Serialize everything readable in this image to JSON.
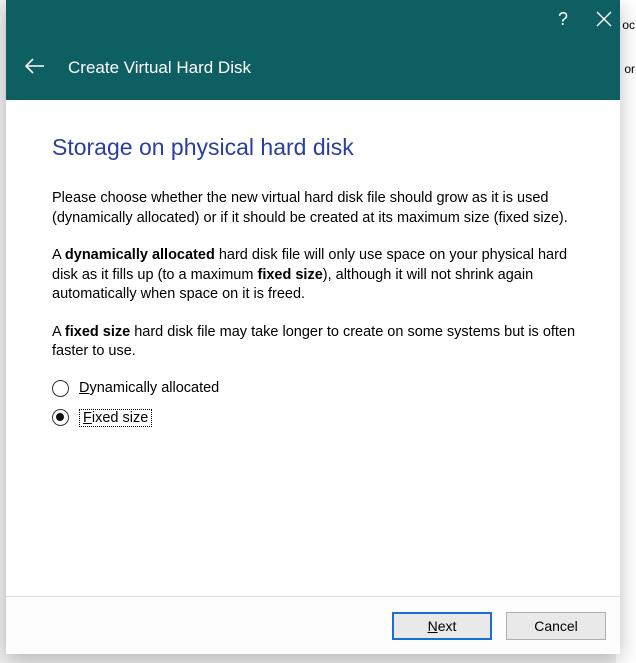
{
  "window": {
    "title": "Create Virtual Hard Disk",
    "help_icon": "?",
    "close_icon": "×",
    "back_icon": "←"
  },
  "page": {
    "heading": "Storage on physical hard disk",
    "paragraphs": {
      "p1": "Please choose whether the new virtual hard disk file should grow as it is used (dynamically allocated) or if it should be created at its maximum size (fixed size).",
      "p2_a": "A ",
      "p2_b_strong": "dynamically allocated",
      "p2_c": " hard disk file will only use space on your physical hard disk as it fills up (to a maximum ",
      "p2_d_strong": "fixed size",
      "p2_e": "), although it will not shrink again automatically when space on it is freed.",
      "p3_a": "A ",
      "p3_b_strong": "fixed size",
      "p3_c": " hard disk file may take longer to create on some systems but is often faster to use."
    }
  },
  "options": {
    "dynamic": {
      "mnemonic": "D",
      "rest": "ynamically allocated",
      "selected": false
    },
    "fixed": {
      "mnemonic": "F",
      "rest": "ixed size",
      "selected": true
    }
  },
  "footer": {
    "next": {
      "mnemonic": "N",
      "rest": "ext"
    },
    "cancel": {
      "label": "Cancel"
    }
  },
  "background_fragments": {
    "top": "oc",
    "bottom": "or"
  }
}
